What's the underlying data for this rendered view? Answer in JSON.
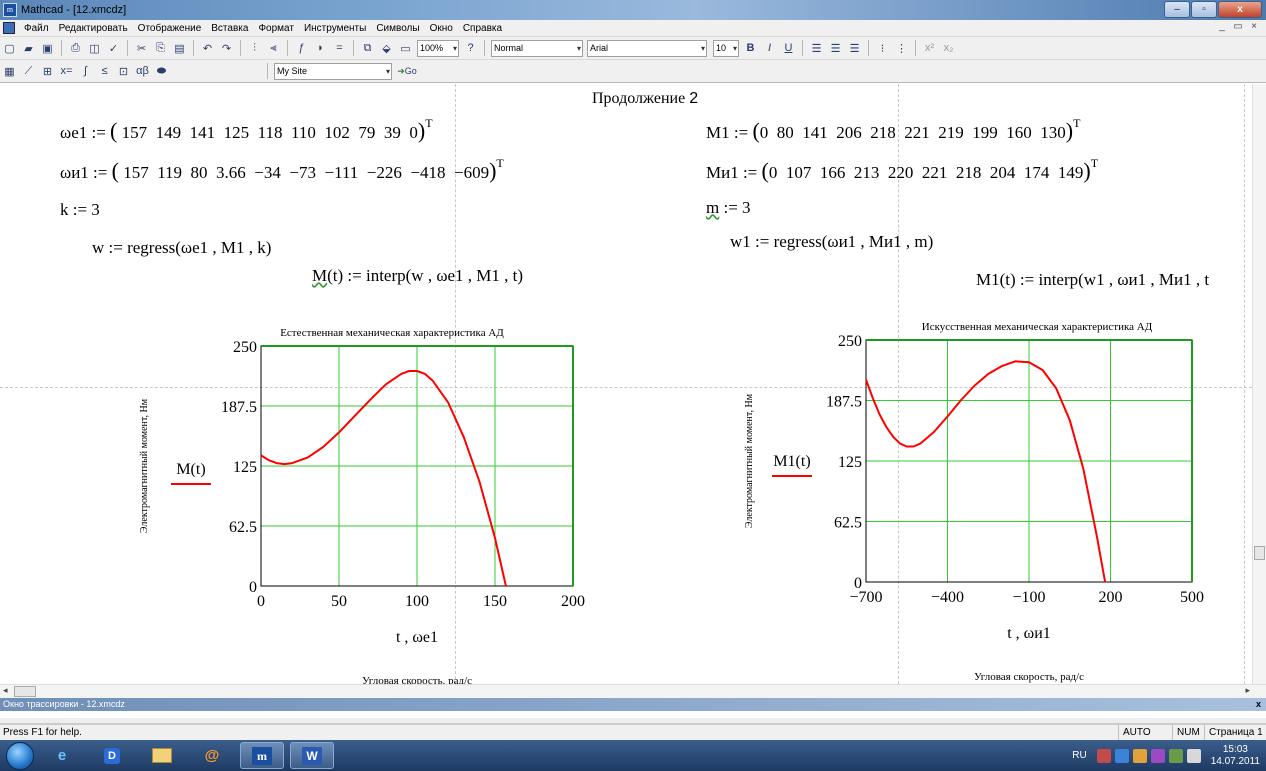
{
  "window": {
    "title": "Mathcad - [12.xmcdz]",
    "controls": {
      "minimize": "‒",
      "maximize": "▫",
      "close": "x"
    }
  },
  "menu": [
    "Файл",
    "Редактировать",
    "Отображение",
    "Вставка",
    "Формат",
    "Инструменты",
    "Символы",
    "Окно",
    "Справка"
  ],
  "toolbar": {
    "zoom": "100%",
    "style": "Normal",
    "font": "Arial",
    "size": "10",
    "bold": "B",
    "italic": "I",
    "underline": "U",
    "site": "My Site",
    "go": "Go"
  },
  "worksheet": {
    "heading_text": "Продолжение",
    "heading_num": "2",
    "left": {
      "we1_lhs": "ωe1 := ",
      "we1_vals": "157  149  141  125  118  110  102  79  39  0",
      "wi1_lhs": "ωи1 := ",
      "wi1_vals": "157  119  80  3.66  −34  −73  −111  −226  −418  −609",
      "k": "k := 3",
      "w": "w := regress(ωe1 , M1 , k)",
      "M_name": "M",
      "M_rest": "(t) := interp(w , ωe1 , M1 , t)"
    },
    "right": {
      "M1_lhs": "M1 := ",
      "M1_vals": "0  80  141  206  218  221  219  199  160  130",
      "Mi1_lhs": "Mи1 := ",
      "Mi1_vals": "0  107  166  213  220  221  218  204  174  149",
      "m_name": "m",
      "m_rest": " := 3",
      "w1": "w1 := regress(ωи1 , Mи1 , m)",
      "M1t": "M1(t) := interp(w1 , ωи1 , Mи1 , t"
    },
    "transpose": "T"
  },
  "chart_data": [
    {
      "type": "line",
      "title": "Естественная механическая характеристика АД",
      "xlabel": "t , ωe1",
      "ylabel": "Электромагнитный момент, Нм",
      "series_label": "M(t)",
      "caption": "Угловая скорость, рад/с",
      "xlim": [
        0,
        200
      ],
      "ylim": [
        0,
        250
      ],
      "xticks": [
        "0",
        "50",
        "100",
        "150",
        "200"
      ],
      "yticks": [
        "0",
        "62.5",
        "125",
        "187.5",
        "250"
      ],
      "grid": true,
      "series": [
        {
          "color": "#ff0000",
          "x": [
            0,
            5,
            10,
            15,
            20,
            30,
            40,
            50,
            60,
            70,
            80,
            90,
            95,
            100,
            105,
            110,
            120,
            130,
            140,
            150,
            157
          ],
          "y": [
            136,
            131,
            128,
            127,
            128,
            134,
            145,
            160,
            177,
            194,
            210,
            221,
            224,
            224,
            221,
            214,
            191,
            155,
            109,
            50,
            0
          ]
        }
      ]
    },
    {
      "type": "line",
      "title": "Искусственная механическая характеристика АД",
      "xlabel": "t , ωи1",
      "ylabel": "Электромагнитный момент, Нм",
      "series_label": "M1(t)",
      "caption": "Угловая скорость, рад/с",
      "xlim": [
        -700,
        500
      ],
      "ylim": [
        0,
        250
      ],
      "xticks": [
        "−700",
        "−400",
        "−100",
        "200",
        "500"
      ],
      "yticks": [
        "0",
        "62.5",
        "125",
        "187.5",
        "250"
      ],
      "grid": true,
      "series": [
        {
          "color": "#ff0000",
          "x": [
            -700,
            -675,
            -650,
            -625,
            -600,
            -575,
            -550,
            -525,
            -500,
            -450,
            -400,
            -350,
            -300,
            -250,
            -200,
            -150,
            -100,
            -50,
            0,
            50,
            100,
            150,
            180
          ],
          "y": [
            209,
            190,
            173,
            160,
            150,
            143,
            140,
            140,
            143,
            155,
            171,
            188,
            203,
            215,
            223,
            228,
            227,
            219,
            200,
            167,
            117,
            47,
            0
          ]
        }
      ]
    }
  ],
  "trace_window": {
    "title": "Окно трассировки - 12.xmcdz",
    "close": "x"
  },
  "status": {
    "help": "Press F1 for help.",
    "mode": "AUTO",
    "num": "NUM",
    "page": "Страница 1"
  },
  "taskbar": {
    "lang": "RU",
    "time": "15:03",
    "date": "14.07.2011",
    "apps": [
      "ie",
      "app-d",
      "explorer",
      "at",
      "mathcad",
      "word"
    ]
  }
}
